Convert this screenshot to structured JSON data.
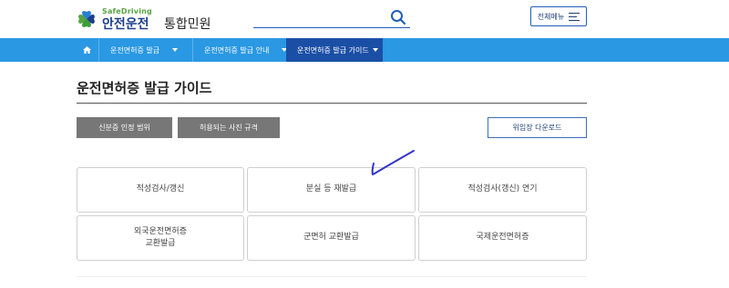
{
  "header": {
    "logo_small": "SafeDriving",
    "logo_main": "안전운전",
    "logo_sub": "통합민원",
    "search_placeholder": "",
    "all_menu_label": "전체메뉴"
  },
  "nav": {
    "items": [
      {
        "label": "운전면허증 발급"
      },
      {
        "label": "운전면허증 발급 안내"
      },
      {
        "label": "운전면허증 발급 가이드"
      }
    ]
  },
  "main": {
    "title": "운전면허증 발급 가이드",
    "buttons": {
      "id_scope": "신분증 인정 범위",
      "photo_spec": "허용되는 사진 규격",
      "download": "위임장 다운로드"
    },
    "cards": [
      "적성검사/갱신",
      "분실 등 재발급",
      "적성검사(갱신) 연기",
      "외국운전면허증\n교환발급",
      "군면허 교환발급",
      "국제운전면허증"
    ]
  },
  "colors": {
    "nav_bg": "#2a98e3",
    "nav_active": "#1b4fa6",
    "gray_button": "#777777",
    "brand_blue": "#1e3f8a",
    "brand_green": "#58a443",
    "annotation": "#3333cc"
  },
  "icons": [
    "logo-clover-icon",
    "search-icon",
    "hamburger-icon",
    "home-icon",
    "chevron-down-icon",
    "annotation-check-icon"
  ]
}
